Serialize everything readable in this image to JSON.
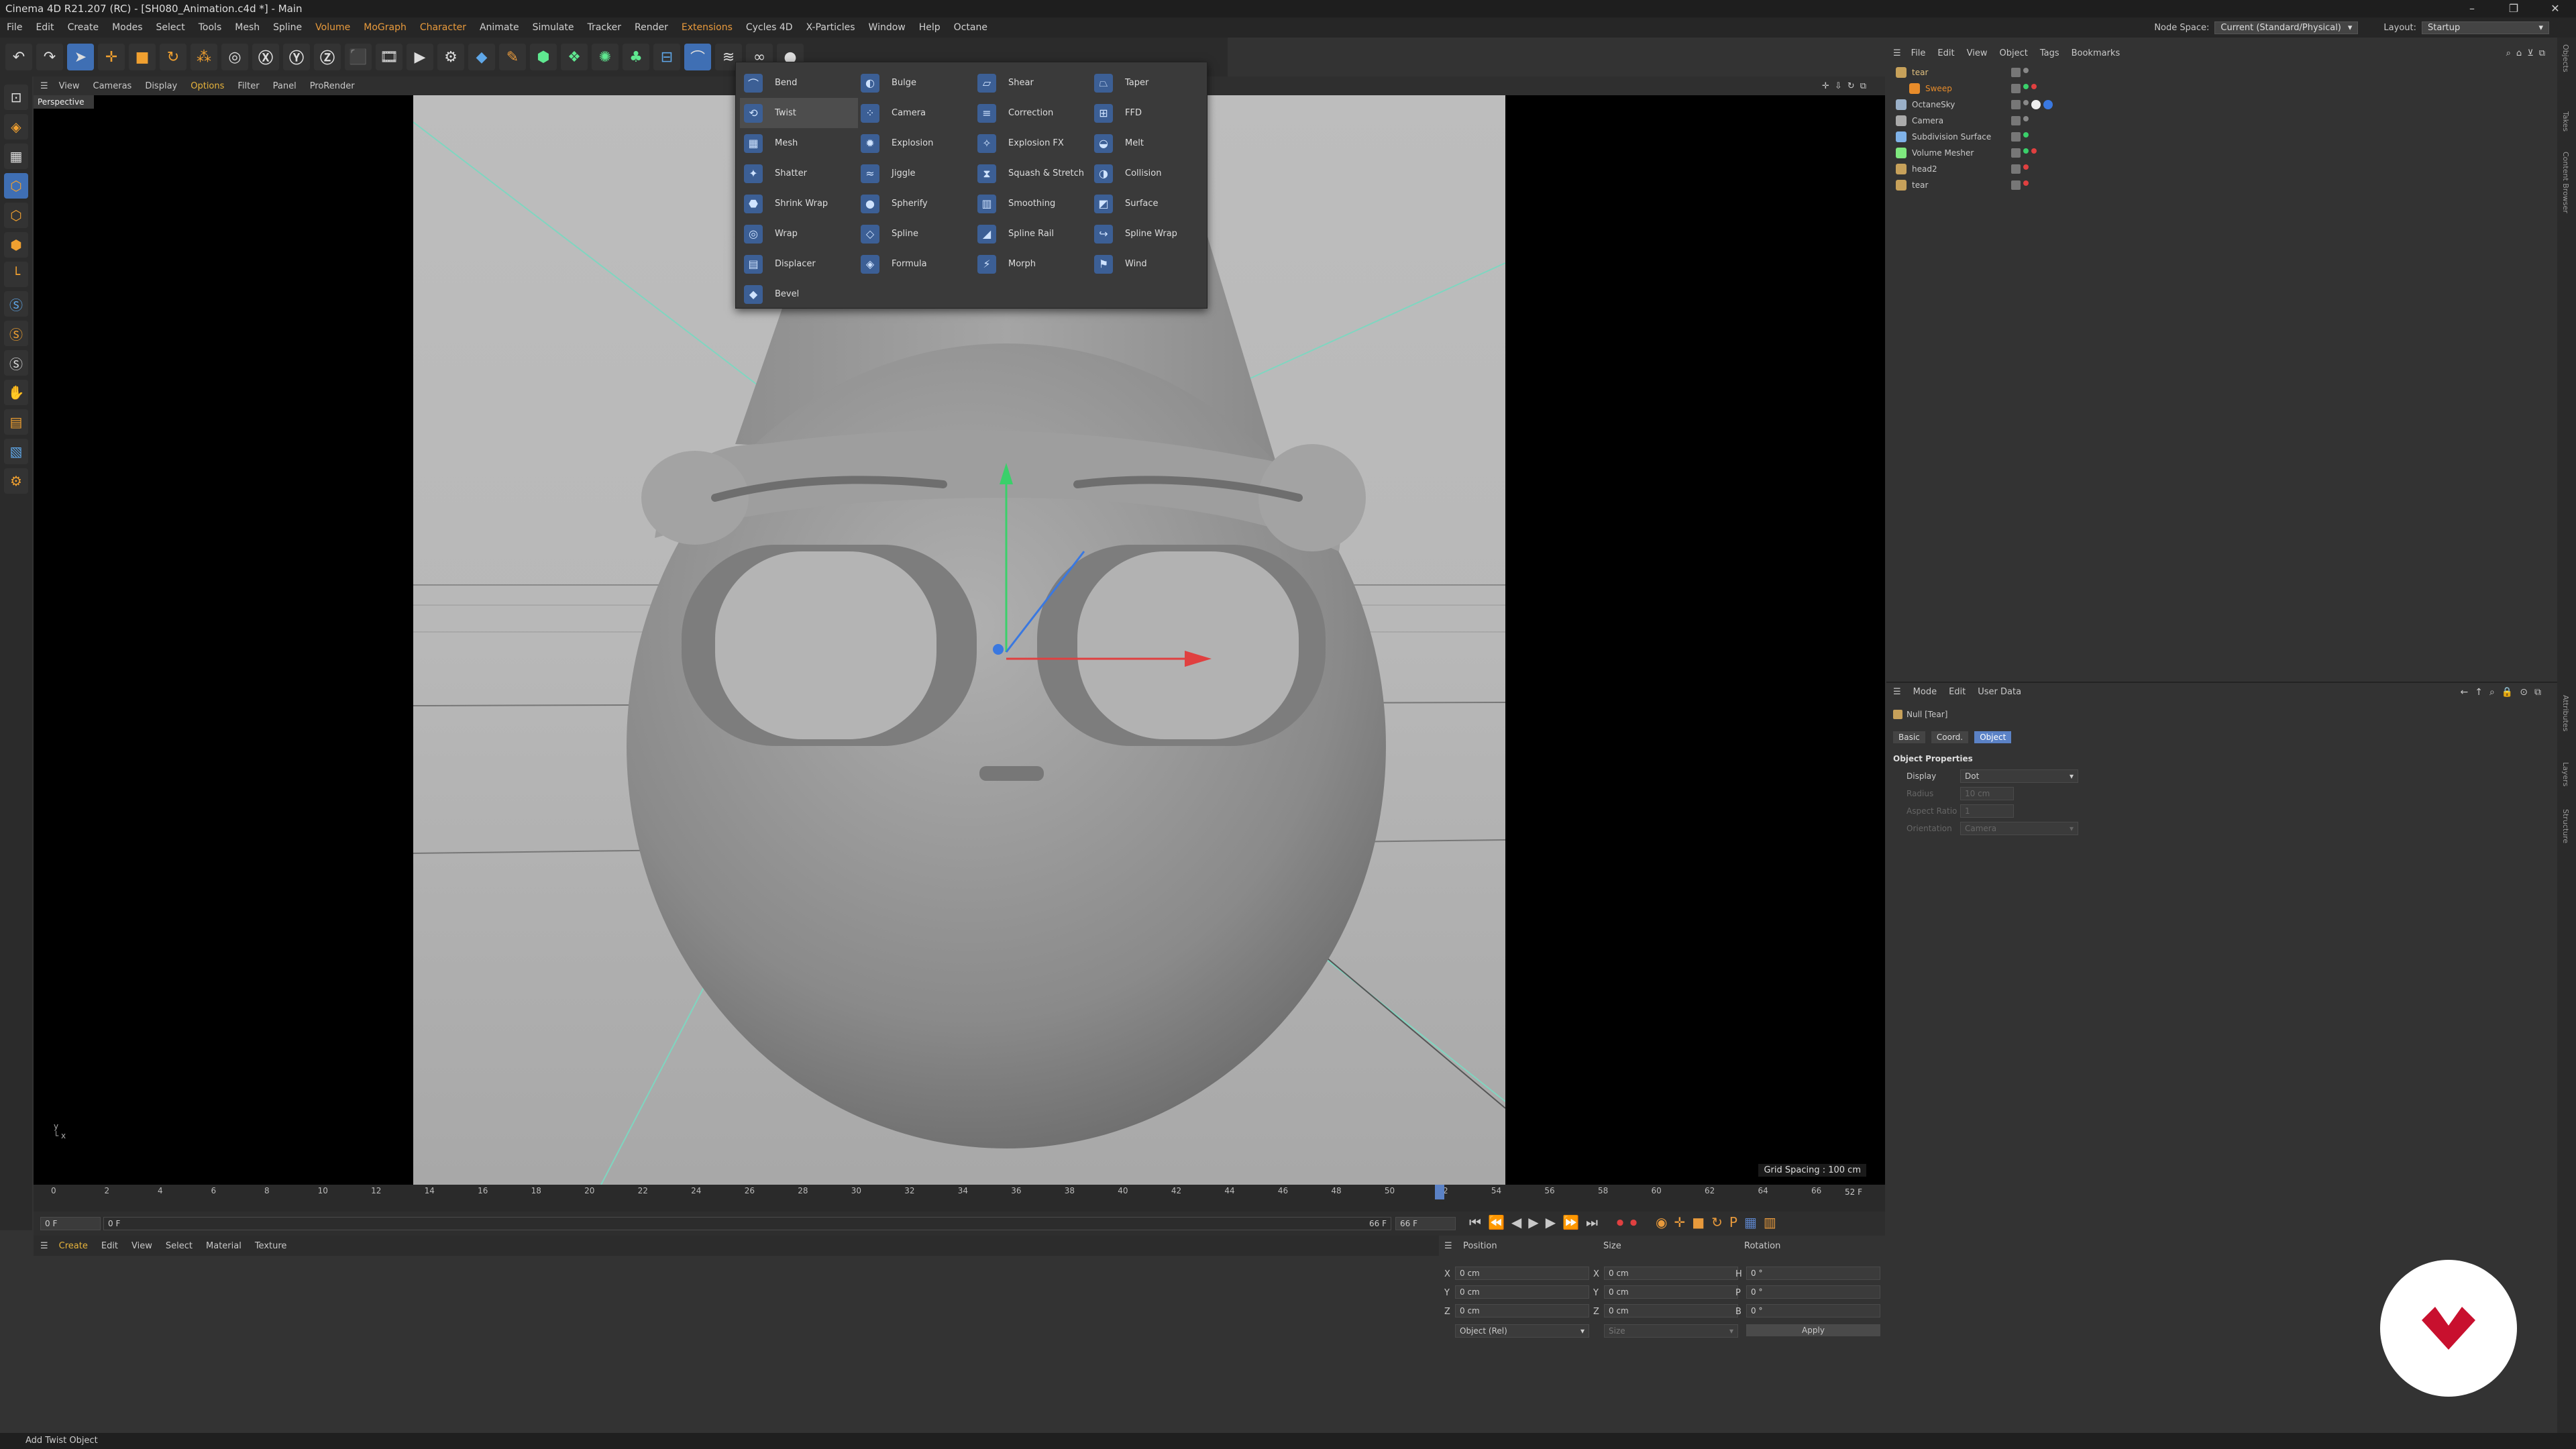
{
  "title": "Cinema 4D R21.207 (RC) - [SH080_Animation.c4d *] - Main",
  "window_controls": [
    "–",
    "❐",
    "✕"
  ],
  "menubar": {
    "items": [
      "File",
      "Edit",
      "Create",
      "Modes",
      "Select",
      "Tools",
      "Mesh",
      "Spline",
      "Volume",
      "MoGraph",
      "Character",
      "Animate",
      "Simulate",
      "Tracker",
      "Render",
      "Extensions",
      "Cycles 4D",
      "X-Particles",
      "Window",
      "Help",
      "Octane"
    ],
    "node_space_label": "Node Space:",
    "node_space_value": "Current (Standard/Physical)",
    "layout_label": "Layout:",
    "layout_value": "Startup"
  },
  "viewport": {
    "menu": [
      "View",
      "Cameras",
      "Display",
      "Options",
      "Filter",
      "Panel",
      "ProRender"
    ],
    "tab": "Perspective",
    "grid_spacing": "Grid Spacing : 100 cm"
  },
  "deformer_menu": {
    "columns": [
      [
        "Bend",
        "Twist",
        "Mesh",
        "Shatter",
        "Shrink Wrap",
        "Wrap",
        "Displacer",
        "Bevel"
      ],
      [
        "Bulge",
        "Camera",
        "Explosion",
        "Jiggle",
        "Spherify",
        "Spline",
        "Formula"
      ],
      [
        "Shear",
        "Correction",
        "Explosion FX",
        "Squash & Stretch",
        "Smoothing",
        "Spline Rail",
        "Morph"
      ],
      [
        "Taper",
        "FFD",
        "Melt",
        "Collision",
        "Surface",
        "Spline Wrap",
        "Wind"
      ]
    ],
    "selected": "Twist"
  },
  "timeline": {
    "ticks": [
      "0",
      "2",
      "4",
      "6",
      "8",
      "10",
      "12",
      "14",
      "16",
      "18",
      "20",
      "22",
      "24",
      "26",
      "28",
      "30",
      "32",
      "34",
      "36",
      "38",
      "40",
      "42",
      "44",
      "46",
      "48",
      "50",
      "52",
      "54",
      "56",
      "58",
      "60",
      "62",
      "64",
      "66"
    ],
    "current_frame": "52 F",
    "start": "0 F",
    "range_start": "0 F",
    "range_end": "66 F",
    "end": "66 F",
    "playhead": 52,
    "max": 66
  },
  "material_manager": {
    "menu": [
      "Create",
      "Edit",
      "View",
      "Select",
      "Material",
      "Texture"
    ]
  },
  "coordinates": {
    "headers": [
      "Position",
      "Size",
      "Rotation"
    ],
    "rows": [
      {
        "axis": "X",
        "pos": "0 cm",
        "size_axis": "X",
        "size": "0 cm",
        "rot_axis": "H",
        "rot": "0 °"
      },
      {
        "axis": "Y",
        "pos": "0 cm",
        "size_axis": "Y",
        "size": "0 cm",
        "rot_axis": "P",
        "rot": "0 °"
      },
      {
        "axis": "Z",
        "pos": "0 cm",
        "size_axis": "Z",
        "size": "0 cm",
        "rot_axis": "B",
        "rot": "0 °"
      }
    ],
    "mode": "Object (Rel)",
    "size_mode": "Size",
    "apply": "Apply"
  },
  "objects": {
    "menu": [
      "File",
      "Edit",
      "View",
      "Object",
      "Tags",
      "Bookmarks"
    ],
    "items": [
      {
        "name": "tear",
        "color": "#c7a15a"
      },
      {
        "name": "Sweep",
        "color": "#e88c2a"
      },
      {
        "name": "OctaneSky",
        "color": "#9ab0c8"
      },
      {
        "name": "Camera",
        "color": "#aaaaaa"
      },
      {
        "name": "Subdivision Surface",
        "color": "#7fb2e8"
      },
      {
        "name": "Volume Mesher",
        "color": "#7fe87f"
      },
      {
        "name": "head2",
        "color": "#c7a15a"
      },
      {
        "name": "tear",
        "color": "#c7a15a"
      }
    ]
  },
  "attributes": {
    "menu": [
      "Mode",
      "Edit",
      "User Data"
    ],
    "object_name": "Null [Tear]",
    "tabs": [
      "Basic",
      "Coord.",
      "Object"
    ],
    "active_tab": "Object",
    "section": "Object Properties",
    "props": [
      {
        "label": "Display",
        "value": "Dot"
      },
      {
        "label": "Radius",
        "value": "10 cm"
      },
      {
        "label": "Aspect Ratio",
        "value": "1"
      },
      {
        "label": "Orientation",
        "value": "Camera"
      }
    ]
  },
  "right_tabs": [
    "Objects",
    "Takes",
    "Content Browser",
    "Attributes",
    "Layers",
    "Structure"
  ],
  "status": "Add Twist Object"
}
